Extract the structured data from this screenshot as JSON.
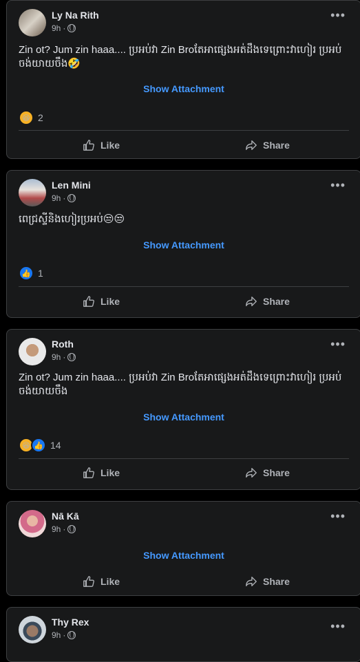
{
  "posts": [
    {
      "author": "Ly Na Rith",
      "time": "9h",
      "text": "Zin ot? Jum zin haaa.... ប្រអប់វា Zin Broតែអាផ្សេងអត់ដឹងទេព្រោះវាហៀរ ប្រអប់ ចង់យាយចឹង🤣",
      "attachment": "Show Attachment",
      "reaction_count": "2",
      "like_label": "Like",
      "share_label": "Share"
    },
    {
      "author": "Len Mini",
      "time": "9h",
      "text": "ពេជ្រស្ទីនិងហៀរប្រអប់😒😒",
      "attachment": "Show Attachment",
      "reaction_count": "1",
      "like_label": "Like",
      "share_label": "Share"
    },
    {
      "author": "Roth",
      "time": "9h",
      "text": "Zin ot? Jum zin haaa.... ប្រអប់វា Zin Broតែអាផ្សេងអត់ដឹងទេព្រោះវាហៀរ ប្រអប់ ចង់យាយចឹង",
      "attachment": "Show Attachment",
      "reaction_count": "14",
      "like_label": "Like",
      "share_label": "Share"
    },
    {
      "author": "Nā Kā",
      "time": "9h",
      "attachment": "Show Attachment",
      "like_label": "Like",
      "share_label": "Share"
    },
    {
      "author": "Thy Rex",
      "time": "9h"
    }
  ],
  "icons": {
    "more": "more-options-icon",
    "globe": "globe-icon",
    "like": "thumbs-up-icon",
    "share": "share-icon"
  },
  "colors": {
    "background": "#000000",
    "card": "#18191a",
    "link": "#4599ff",
    "muted": "#b0b3b8"
  }
}
